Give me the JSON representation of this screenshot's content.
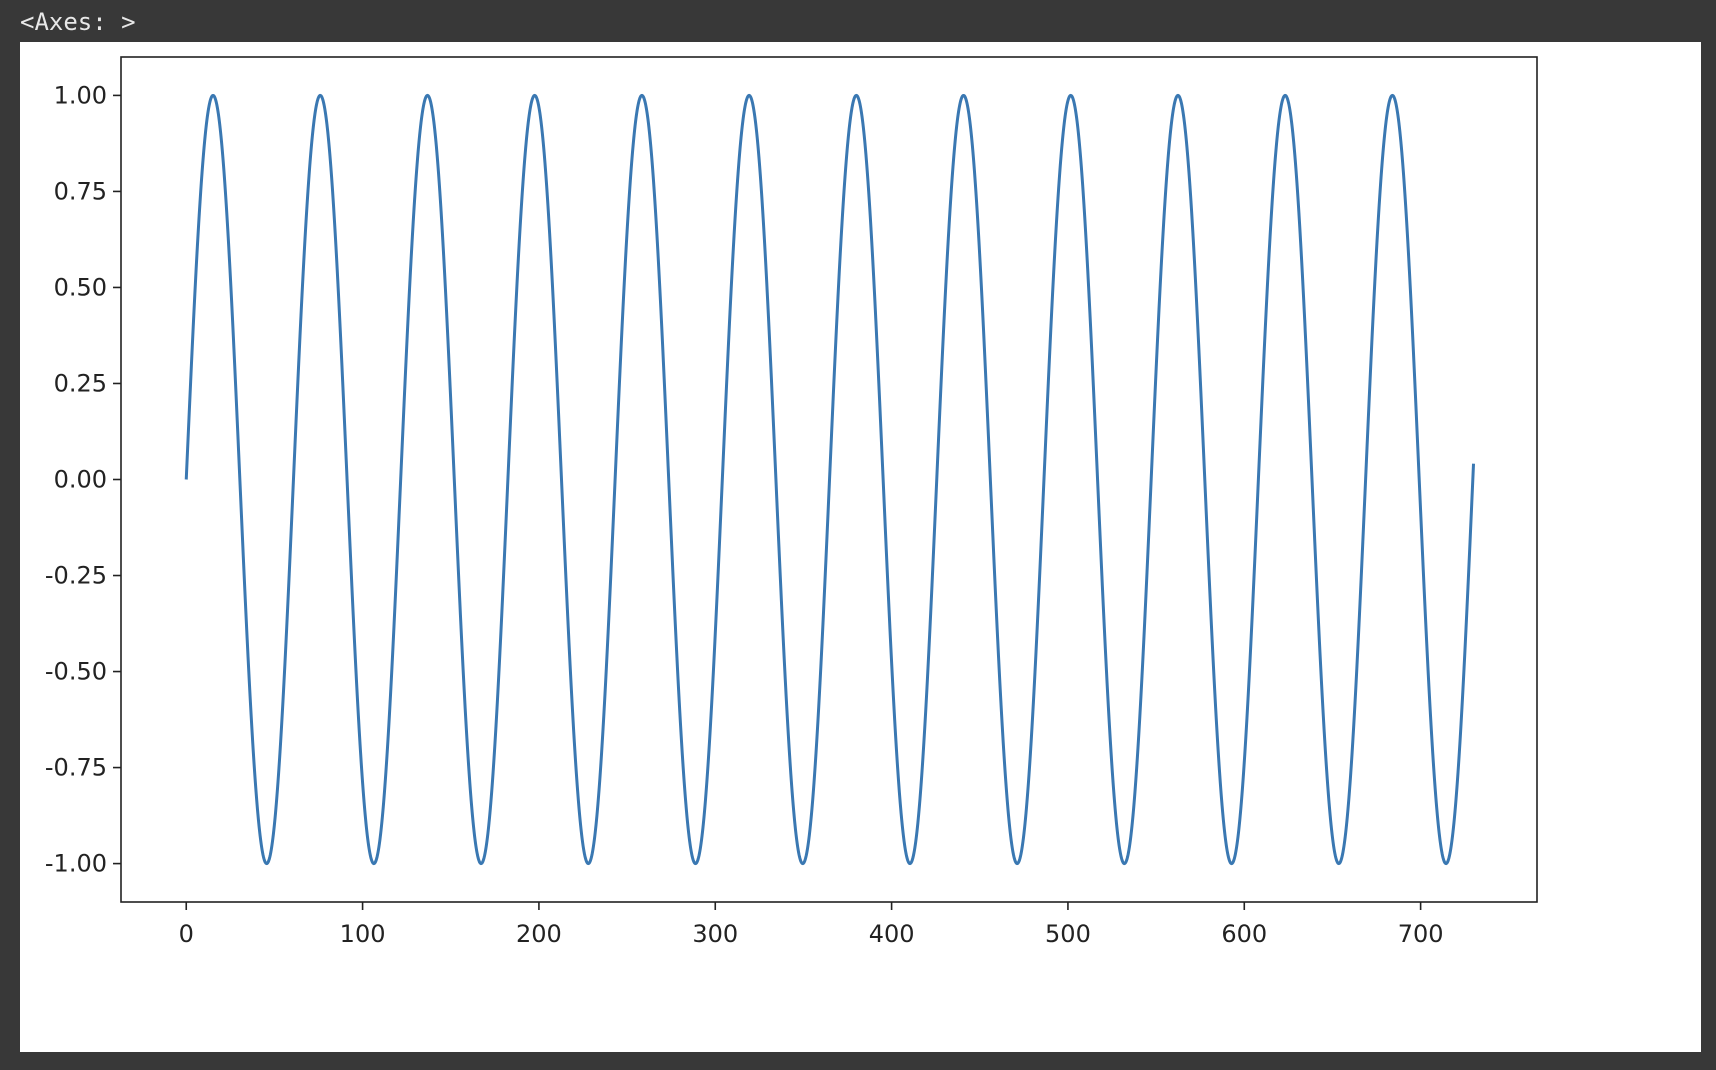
{
  "output": {
    "repr": "<Axes: >"
  },
  "chart_data": {
    "type": "line",
    "function": "sin",
    "x_start": 0,
    "x_end": 730,
    "period": 60.8,
    "amplitude": 1,
    "xlim": [
      -37,
      766
    ],
    "ylim": [
      -1.1,
      1.1
    ],
    "xticks": [
      0,
      100,
      200,
      300,
      400,
      500,
      600,
      700
    ],
    "xtick_labels": [
      "0",
      "100",
      "200",
      "300",
      "400",
      "500",
      "600",
      "700"
    ],
    "yticks": [
      1.0,
      0.75,
      0.5,
      0.25,
      0.0,
      -0.25,
      -0.5,
      -0.75,
      -1.0
    ],
    "ytick_labels": [
      "1.00",
      "0.75",
      "0.50",
      "0.25",
      "0.00",
      "-0.25",
      "-0.50",
      "-0.75",
      "-1.00"
    ],
    "series": [
      {
        "color": "#3a78b2"
      }
    ],
    "grid": false,
    "title": "",
    "xlabel": "",
    "ylabel": ""
  }
}
